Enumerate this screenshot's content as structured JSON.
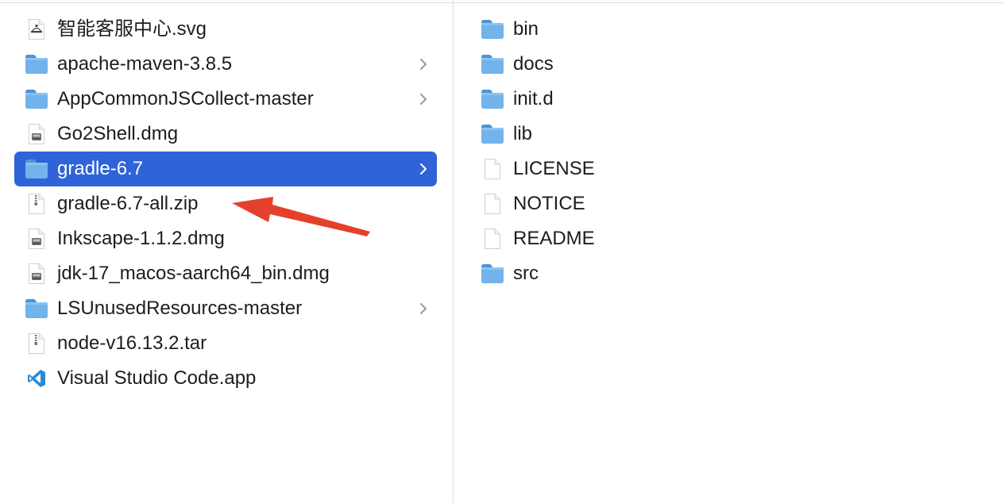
{
  "colors": {
    "selection": "#2f63d8",
    "folder_body": "#71b3ea",
    "folder_tab": "#4a95d8",
    "annotation_arrow": "#e5402b"
  },
  "left_column": {
    "items": [
      {
        "label": "智能客服中心.svg",
        "icon": "svg-file-icon"
      },
      {
        "label": "apache-maven-3.8.5",
        "icon": "folder-icon",
        "has_children": true
      },
      {
        "label": "AppCommonJSCollect-master",
        "icon": "folder-icon",
        "has_children": true
      },
      {
        "label": "Go2Shell.dmg",
        "icon": "disk-image-icon"
      },
      {
        "label": "gradle-6.7",
        "icon": "folder-icon",
        "has_children": true,
        "selected": true
      },
      {
        "label": "gradle-6.7-all.zip",
        "icon": "zip-file-icon"
      },
      {
        "label": "Inkscape-1.1.2.dmg",
        "icon": "disk-image-icon"
      },
      {
        "label": "jdk-17_macos-aarch64_bin.dmg",
        "icon": "disk-image-icon"
      },
      {
        "label": "LSUnusedResources-master",
        "icon": "folder-icon",
        "has_children": true
      },
      {
        "label": "node-v16.13.2.tar",
        "icon": "zip-file-icon"
      },
      {
        "label": "Visual Studio Code.app",
        "icon": "vscode-app-icon"
      }
    ]
  },
  "right_column": {
    "items": [
      {
        "label": "bin",
        "icon": "folder-icon"
      },
      {
        "label": "docs",
        "icon": "folder-icon"
      },
      {
        "label": "init.d",
        "icon": "folder-icon"
      },
      {
        "label": "lib",
        "icon": "folder-icon"
      },
      {
        "label": "LICENSE",
        "icon": "document-icon"
      },
      {
        "label": "NOTICE",
        "icon": "document-icon"
      },
      {
        "label": "README",
        "icon": "document-icon"
      },
      {
        "label": "src",
        "icon": "folder-icon"
      }
    ]
  }
}
